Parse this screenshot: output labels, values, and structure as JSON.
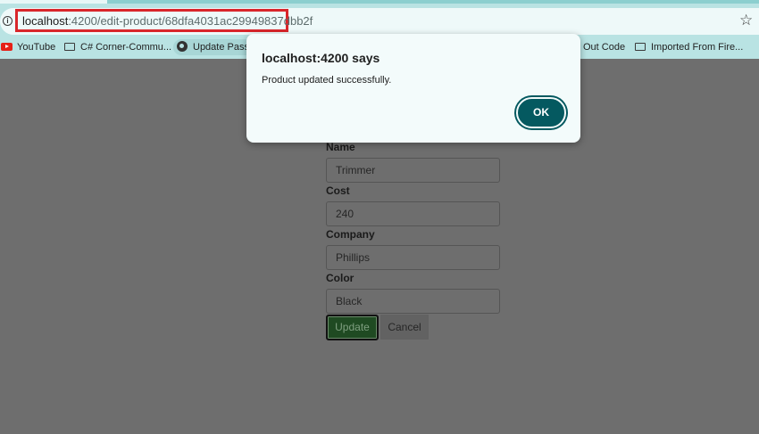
{
  "browser": {
    "url_host": "localhost",
    "url_rest": ":4200/edit-product/68dfa4031ac29949837dbb2f",
    "bookmarks": [
      {
        "label": "YouTube",
        "icon": "youtube-icon"
      },
      {
        "label": "C# Corner-Commu...",
        "icon": "folder-icon"
      },
      {
        "label": "Update Passw",
        "icon": "globe-icon"
      },
      {
        "label": "Out Code",
        "icon": "none"
      },
      {
        "label": "Imported From Fire...",
        "icon": "folder-icon"
      }
    ]
  },
  "dialog": {
    "title": "localhost:4200 says",
    "message": "Product updated successfully.",
    "ok_label": "OK"
  },
  "form": {
    "fields": [
      {
        "label": "Name",
        "value": "Trimmer"
      },
      {
        "label": "Cost",
        "value": "240"
      },
      {
        "label": "Company",
        "value": "Phillips"
      },
      {
        "label": "Color",
        "value": "Black"
      }
    ],
    "update_label": "Update",
    "cancel_label": "Cancel"
  },
  "colors": {
    "highlight": "#d9262b",
    "ok_button": "#045960",
    "update_button": "#1f4a22",
    "overlay": "#6e6e6e"
  }
}
